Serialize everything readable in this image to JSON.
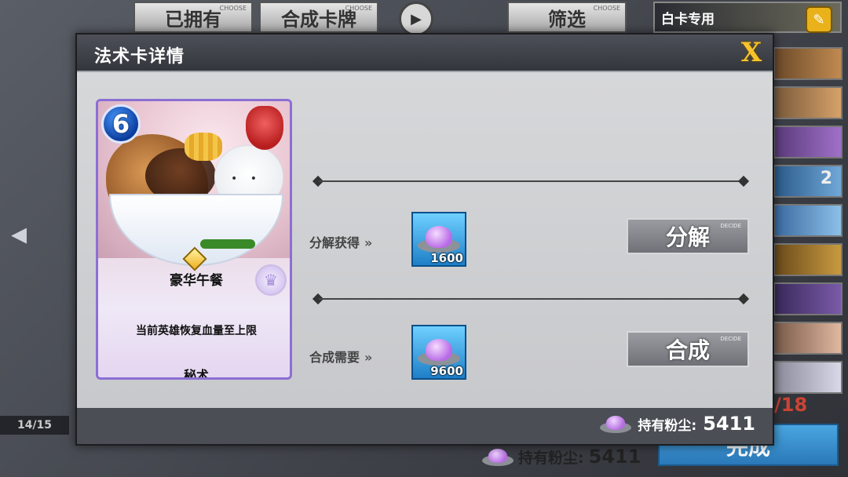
{
  "background": {
    "tabs": {
      "owned": "已拥有",
      "craft_card": "合成卡牌",
      "filter": "筛选",
      "choose_tag": "CHOOSE"
    },
    "white_card_tab": "白卡专用",
    "page_indicator": "14/15",
    "side_card_count": "2",
    "side_ratio": "/18",
    "dust_label": "持有粉尘:",
    "dust_value": "5411",
    "complete_button": "完成",
    "decide_tag": "DECIDE"
  },
  "modal": {
    "title": "法术卡详情",
    "close_icon": "close-x-icon",
    "card": {
      "cost": "6",
      "name": "豪华午餐",
      "description": "当前英雄恢复血量至上限",
      "type": "秘术"
    },
    "disenchant": {
      "label": "分解获得",
      "amount": "1600",
      "button": "分解",
      "decide_tag": "DECIDE"
    },
    "craft": {
      "label": "合成需要",
      "amount": "9600",
      "button": "合成",
      "decide_tag": "DECIDE"
    },
    "footer": {
      "dust_label": "持有粉尘:",
      "dust_value": "5411"
    }
  },
  "colors": {
    "accent_gold": "#f6c32b",
    "cost_blue": "#0b3c9c",
    "card_border": "#8b6fd4",
    "dust_purple": "#b46ce0"
  }
}
